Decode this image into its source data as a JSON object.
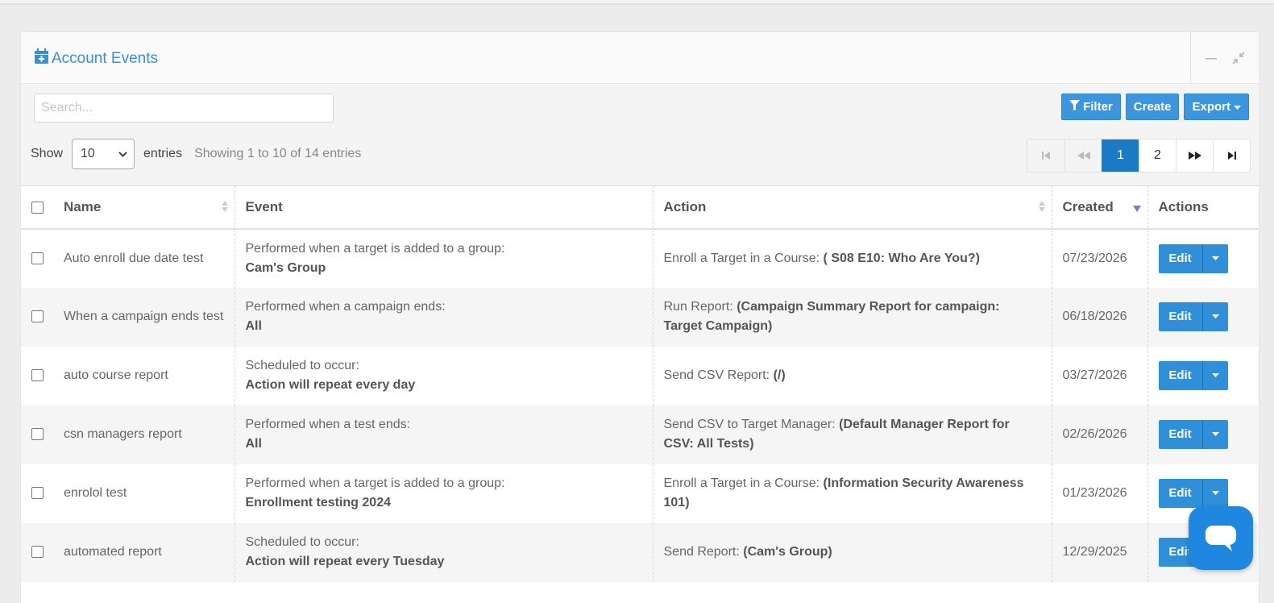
{
  "panel": {
    "title": "Account Events",
    "icon": "calendar-plus-icon"
  },
  "toolbar": {
    "search_placeholder": "Search...",
    "filter_label": "Filter",
    "create_label": "Create",
    "export_label": "Export"
  },
  "length": {
    "show_label": "Show",
    "selected": "10",
    "entries_label": "entries",
    "info": "Showing 1 to 10 of 14 entries"
  },
  "pagination": {
    "pages": [
      "1",
      "2"
    ],
    "current": "1"
  },
  "table": {
    "columns": [
      "Name",
      "Event",
      "Action",
      "Created",
      "Actions"
    ],
    "sorted_column": "Created",
    "sort_direction": "descending",
    "edit_label": "Edit",
    "rows": [
      {
        "name": "Auto enroll due date test",
        "event_text": "Performed when a target is added to a group:",
        "event_value": "Cam's Group",
        "action_text": "Enroll a Target in a Course:",
        "action_value": "( S08 E10: Who Are You?)",
        "created": "07/23/2026"
      },
      {
        "name": "When a campaign ends test",
        "event_text": "Performed when a campaign ends:",
        "event_value": "All",
        "action_text": "Run Report:",
        "action_value": "(Campaign Summary Report for campaign: Target Campaign)",
        "created": "06/18/2026"
      },
      {
        "name": "auto course report",
        "event_text": "Scheduled to occur:",
        "event_value": "Action will repeat every day",
        "action_text": "Send CSV Report:",
        "action_value": "(/)",
        "created": "03/27/2026"
      },
      {
        "name": "csn managers report",
        "event_text": "Performed when a test ends:",
        "event_value": "All",
        "action_text": "Send CSV to Target Manager:",
        "action_value": "(Default Manager Report for CSV: All Tests)",
        "created": "02/26/2026"
      },
      {
        "name": "enrolol test",
        "event_text": "Performed when a target is added to a group:",
        "event_value": "Enrollment testing 2024",
        "action_text": "Enroll a Target in a Course:",
        "action_value": "(Information Security Awareness 101)",
        "created": "01/23/2026"
      },
      {
        "name": "automated report",
        "event_text": "Scheduled to occur:",
        "event_value": "Action will repeat every Tuesday",
        "action_text": "Send Report:",
        "action_value": "(Cam's Group)",
        "created": "12/29/2025"
      }
    ]
  },
  "colors": {
    "accent": "#3c96dd",
    "active_page": "#1a7ac6",
    "title": "#3a8fd5"
  }
}
